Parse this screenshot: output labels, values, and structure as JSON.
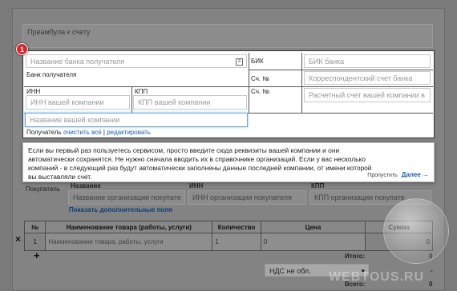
{
  "preamble": {
    "placeholder": "Преамбула к счету"
  },
  "step_badge": "1",
  "bank_block": {
    "bank_name_placeholder": "Название банка получателя",
    "bank_label": "Банк получателя",
    "bik_label": "БИК",
    "bik_placeholder": "БИК банка",
    "corr_label": "Сч. №",
    "corr_placeholder": "Корреспондентский счет банка",
    "inn_label": "ИНН",
    "inn_placeholder": "ИНН вашей компании",
    "kpp_label": "КПП",
    "kpp_placeholder": "КПП вашей компании",
    "acct_label": "Сч. №",
    "acct_placeholder": "Расчетный счет вашей компании в",
    "company_placeholder": "Название вашей компании",
    "recipient_label": "Получатель",
    "clear_all": "очистить всё",
    "separator": "|",
    "edit": "редактировать"
  },
  "hint": {
    "text": "Если вы первый раз пользуетесь сервисом, просто введите сюда реквизиты вашей компании и они автоматически сохранятся. Не нужно сначала вводить их в справочнике организаций. Если у вас несколько компаний - в следующий раз будут автоматически заполнены данные последней компании, от имени которой вы выставляли счет.",
    "skip": "Пропустить",
    "next": "Далее →"
  },
  "payer": {
    "label": "Покупатель",
    "name_header": "Название",
    "inn_header": "ИНН",
    "kpp_header": "КПП",
    "name_placeholder": "Название организации покупате",
    "inn_placeholder": "ИНН организации покупателя",
    "kpp_placeholder": "КПП организации покупате",
    "more_fields": "Показать дополнительные поля"
  },
  "goods": {
    "headers": [
      "№",
      "Наименование товара (работы, услуги)",
      "Количество",
      "Цена",
      "Сумма"
    ],
    "rows": [
      {
        "num": "1",
        "name_placeholder": "Наименование товара, работы, услуги",
        "qty": "1",
        "price": "0",
        "sum": "0"
      }
    ],
    "delete_icon": "×",
    "add_icon": "+"
  },
  "totals": {
    "total_label": "Итого:",
    "total_value": "0",
    "vat_select": "НДС не обл.",
    "vat_value": "-",
    "grand_label": "Всего:",
    "grand_value": "0"
  },
  "watermark": "WEBTOUS.RU"
}
